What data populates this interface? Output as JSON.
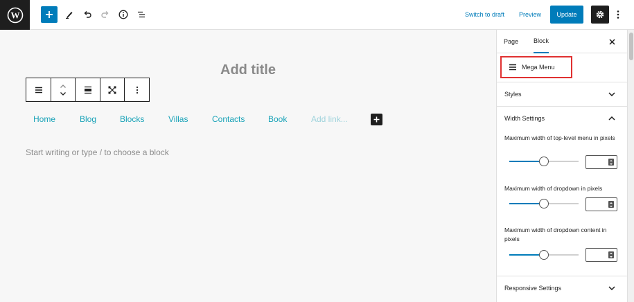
{
  "colors": {
    "accent": "#007cba",
    "nav_link": "#1aa3b8",
    "highlight": "#e03131"
  },
  "topbar": {
    "logo_icon": "wordpress-logo",
    "icons": [
      "plus-icon",
      "pencil-icon",
      "undo-icon",
      "redo-icon",
      "info-icon",
      "list-view-icon",
      "gear-icon",
      "kebab-menu-icon"
    ],
    "switch_to_draft": "Switch to draft",
    "preview": "Preview",
    "update": "Update"
  },
  "editor": {
    "title_placeholder": "Add title",
    "block_toolbar_icons": [
      "menu-block-icon",
      "move-up-down-icon",
      "justify-icon",
      "fullscreen-icon",
      "more-options-icon"
    ],
    "nav_items": [
      "Home",
      "Blog",
      "Blocks",
      "Villas",
      "Contacts",
      "Book"
    ],
    "add_link": "Add link...",
    "body_placeholder": "Start writing or type / to choose a block"
  },
  "sidebar": {
    "tabs": [
      "Page",
      "Block"
    ],
    "active_tab": "Block",
    "block_name": "Mega Menu",
    "panels": {
      "styles": "Styles",
      "width_settings": "Width Settings",
      "responsive_settings": "Responsive Settings"
    },
    "width_controls": [
      {
        "label": "Maximum width of top-level menu in pixels",
        "slider_fraction": 0.5,
        "value": ""
      },
      {
        "label": "Maximum width of dropdown in pixels",
        "slider_fraction": 0.5,
        "value": ""
      },
      {
        "label": "Maximum width of dropdown content in pixels",
        "slider_fraction": 0.5,
        "value": ""
      }
    ]
  }
}
